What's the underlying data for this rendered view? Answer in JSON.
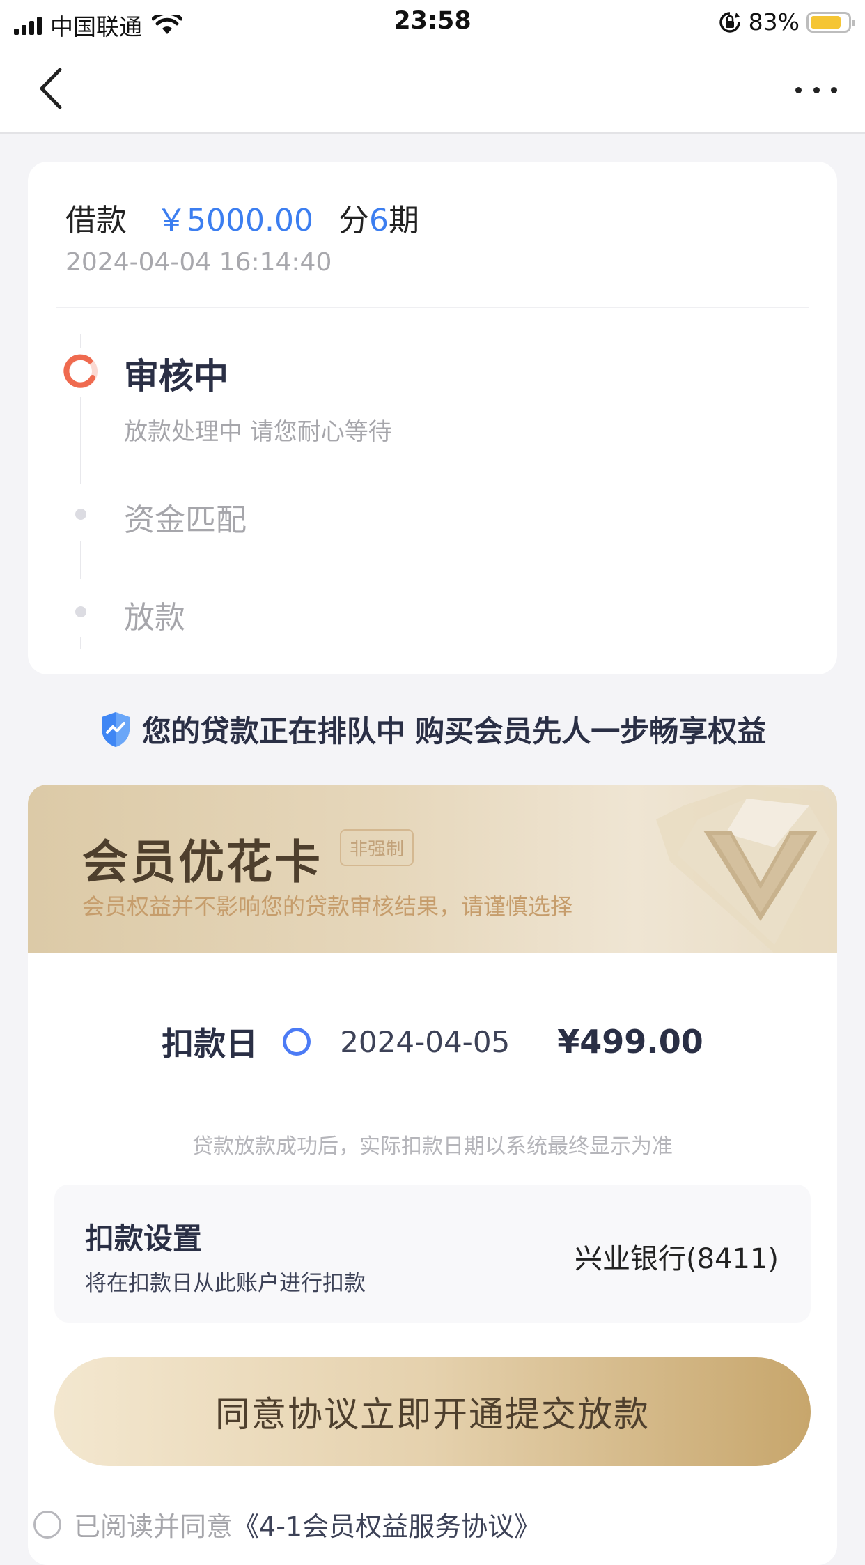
{
  "status_bar": {
    "carrier": "中国联通",
    "time": "23:58",
    "battery_percent": "83%",
    "battery_level": 0.83,
    "battery_color": "#f5c534"
  },
  "nav": {
    "back_icon": "chevron-left-icon",
    "more_icon": "more-horizontal-icon"
  },
  "loan": {
    "label": "借款",
    "amount": "￥5000.00",
    "term_prefix": "分",
    "term_number": "6",
    "term_suffix": "期",
    "timestamp": "2024-04-04 16:14:40",
    "accent_color": "#3c7ef0"
  },
  "progress": {
    "steps": [
      {
        "title": "审核中",
        "description": "放款处理中 请您耐心等待",
        "state": "active"
      },
      {
        "title": "资金匹配",
        "state": "pending"
      },
      {
        "title": "放款",
        "state": "pending"
      }
    ]
  },
  "notice": {
    "icon": "shield-icon",
    "text": "您的贷款正在排队中 购买会员先人一步畅享权益"
  },
  "membership": {
    "title": "会员优花卡",
    "badge": "非强制",
    "subtitle": "会员权益并不影响您的贷款审核结果，请谨慎选择",
    "emblem_icon": "diamond-v-icon",
    "deduct_label": "扣款日",
    "deduct_date": "2024-04-05",
    "deduct_amount": "¥499.00",
    "deduct_note": "贷款放款成功后，实际扣款日期以系统最终显示为准",
    "account": {
      "title": "扣款设置",
      "description": "将在扣款日从此账户进行扣款",
      "bank": "兴业银行(8411)"
    },
    "cta_label": "同意协议立即开通提交放款"
  },
  "agreement": {
    "prefix": "已阅读并同意",
    "link": "《4-1会员权益服务协议》"
  }
}
